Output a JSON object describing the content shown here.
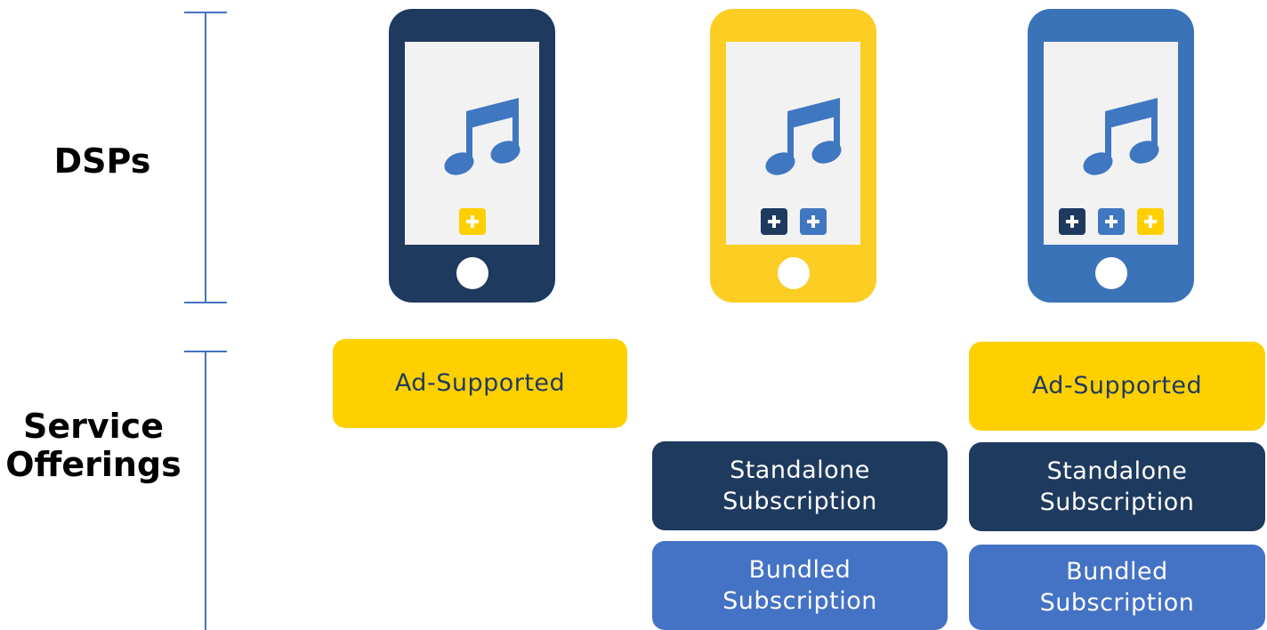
{
  "labels": {
    "dsps": "DSPs",
    "service_offerings_line1": "Service",
    "service_offerings_line2": "Offerings"
  },
  "colors": {
    "navy": "#1F3A5F",
    "yellow": "#FFD000",
    "blue": "#3B73B9",
    "note": "#3F77C1",
    "bracket": "#4472C4"
  },
  "phones": [
    {
      "name": "navy-phone",
      "color": "#1F3A5F",
      "plus_colors": [
        "#FFD000"
      ]
    },
    {
      "name": "yellow-phone",
      "color": "#FFD000",
      "plus_colors": [
        "#1F3A5F",
        "#3F77C1"
      ]
    },
    {
      "name": "blue-phone",
      "color": "#3B73B9",
      "plus_colors": [
        "#1F3A5F",
        "#3F77C1",
        "#FFD000"
      ]
    }
  ],
  "offerings": {
    "ad_supported": "Ad-Supported",
    "standalone_line1": "Standalone",
    "standalone_line2": "Subscription",
    "bundled_line1": "Bundled",
    "bundled_line2": "Subscription"
  }
}
